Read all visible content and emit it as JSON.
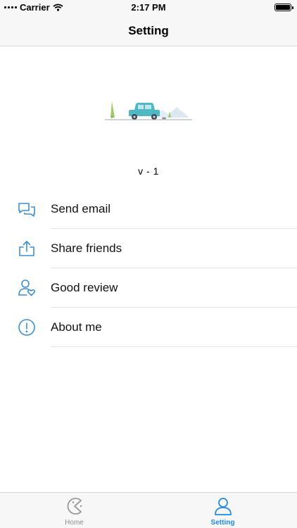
{
  "status_bar": {
    "carrier": "Carrier",
    "time": "2:17 PM",
    "wifi_icon": "wifi-icon",
    "battery_level": 1.0
  },
  "nav": {
    "title": "Setting"
  },
  "hero": {
    "image": "car-landscape-illustration"
  },
  "version": "v - 1",
  "menu": {
    "items": [
      {
        "label": "Send email",
        "icon": "chat-bubbles-icon"
      },
      {
        "label": "Share friends",
        "icon": "share-icon"
      },
      {
        "label": "Good review",
        "icon": "user-heart-icon"
      },
      {
        "label": "About me",
        "icon": "info-icon"
      }
    ]
  },
  "tabs": [
    {
      "label": "Home",
      "icon": "pacman-icon",
      "selected": false
    },
    {
      "label": "Setting",
      "icon": "user-icon",
      "selected": true
    }
  ],
  "colors": {
    "accent": "#1e88e5",
    "icon_blue": "#3a8ed4",
    "car": "#4fb8c2",
    "tree": "#9ccc65",
    "inactive": "#8e8e93"
  }
}
